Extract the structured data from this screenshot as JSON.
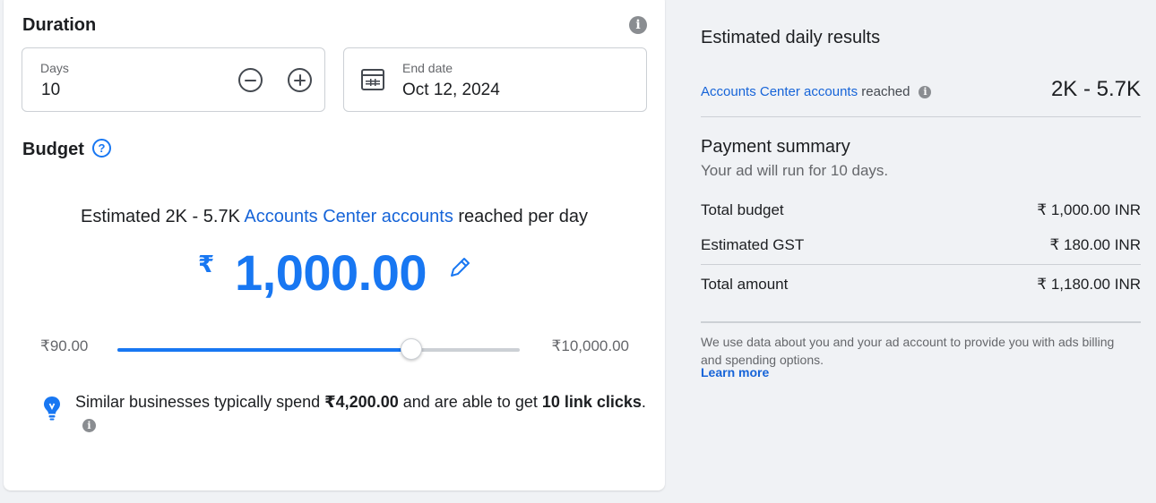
{
  "duration": {
    "title": "Duration",
    "days_label": "Days",
    "days_value": "10",
    "end_date_label": "End date",
    "end_date_value": "Oct 12, 2024"
  },
  "budget": {
    "title": "Budget",
    "estimate_prefix": "Estimated 2K - 5.7K ",
    "estimate_link": "Accounts Center accounts",
    "estimate_suffix": " reached per day",
    "currency_symbol": "₹",
    "amount": "1,000.00",
    "slider_min_label": "₹90.00",
    "slider_max_label": "₹10,000.00",
    "slider_min": 90,
    "slider_max": 10000,
    "slider_fill_fraction": 0.73,
    "tip_text_1": "Similar businesses typically spend ",
    "tip_bold_amount": "₹4,200.00",
    "tip_text_2": " and are able to get ",
    "tip_bold_result": "10 link clicks",
    "tip_text_3": "."
  },
  "results": {
    "title": "Estimated daily results",
    "reach_link": "Accounts Center accounts",
    "reach_suffix": " reached",
    "reach_value": "2K - 5.7K"
  },
  "payment": {
    "title": "Payment summary",
    "subtitle": "Your ad will run for 10 days.",
    "total_budget_label": "Total budget",
    "total_budget_value": "₹ 1,000.00 INR",
    "gst_label": "Estimated GST",
    "gst_value": "₹ 180.00 INR",
    "total_amount_label": "Total amount",
    "total_amount_value": "₹ 1,180.00 INR",
    "note": "We use data about you and your ad account to provide you with ads billing and spending options.",
    "learn_more": "Learn more"
  },
  "colors": {
    "accent": "#1877f2",
    "link": "#1664d8",
    "page_bg": "#f0f2f5",
    "card_bg": "#ffffff",
    "muted_text": "#65676b"
  },
  "icons": {
    "duration_info": "info-icon",
    "minus": "minus-circle-icon",
    "plus": "plus-circle-icon",
    "end_date": "calendar-icon",
    "budget_help": "question-circle-icon",
    "edit_amount": "pencil-icon",
    "tip": "lightbulb-icon",
    "reach_info": "info-icon"
  }
}
